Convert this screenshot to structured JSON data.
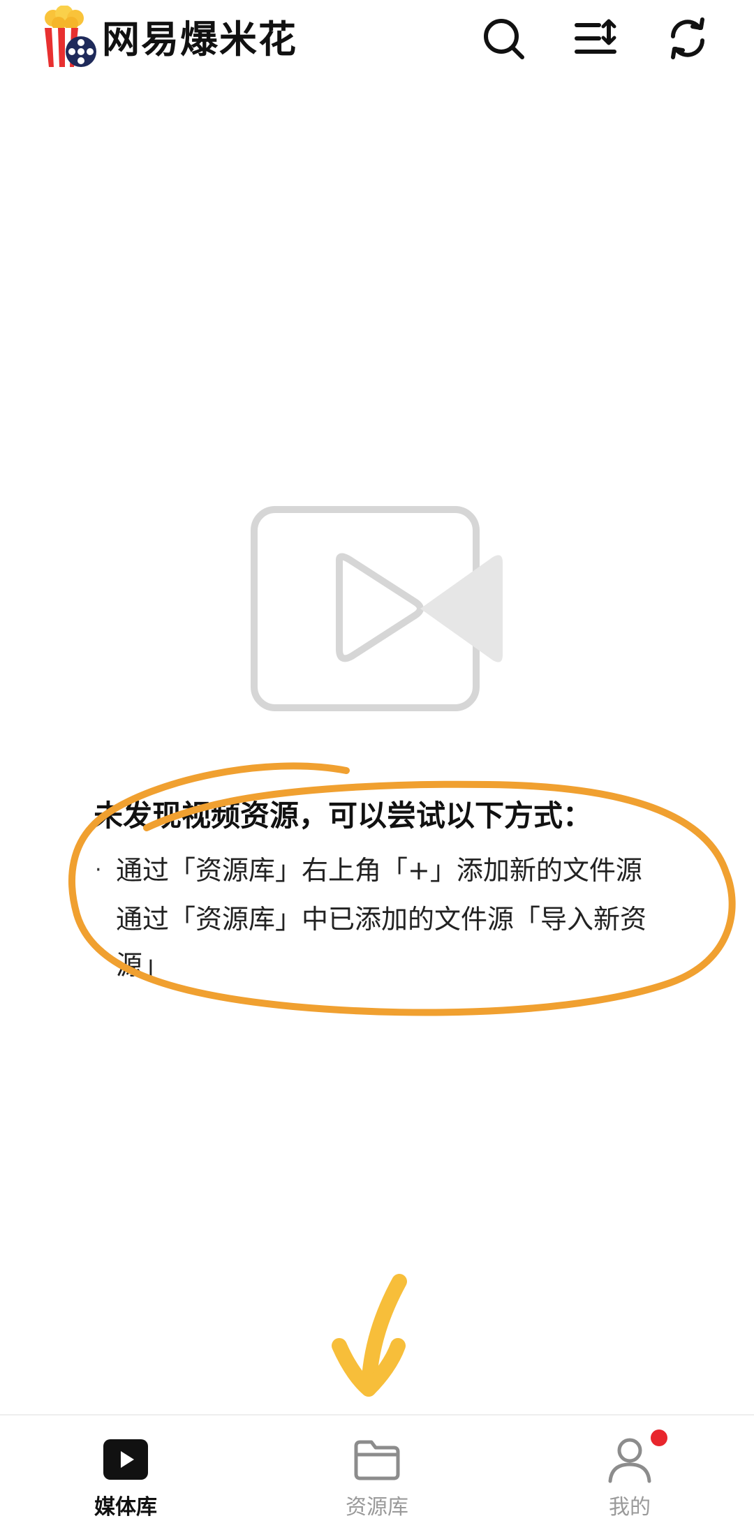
{
  "header": {
    "app_title": "网易爆米花",
    "icons": {
      "logo": "popcorn-film-logo",
      "search": "search-icon",
      "sort": "sort-icon",
      "refresh": "refresh-icon"
    }
  },
  "empty_state": {
    "illustration": "video-camera-placeholder-icon",
    "title": "未发现视频资源，可以尝试以下方式：",
    "tips": [
      "通过「资源库」右上角「+」添加新的文件源",
      "通过「资源库」中已添加的文件源「导入新资源」"
    ],
    "bullet": "·"
  },
  "tab_bar": {
    "tabs": [
      {
        "label": "媒体库",
        "icon": "play-square-icon",
        "active": true
      },
      {
        "label": "资源库",
        "icon": "folder-icon",
        "active": false
      },
      {
        "label": "我的",
        "icon": "user-icon",
        "active": false,
        "badge": true
      }
    ]
  },
  "annotations": {
    "circle_color": "#F0A030",
    "arrow_color": "#F7BE3A"
  },
  "colors": {
    "badge": "#E8262D",
    "placeholder_gray": "#D6D6D6",
    "text_primary": "#111111",
    "text_inactive": "#9A9A9A"
  }
}
